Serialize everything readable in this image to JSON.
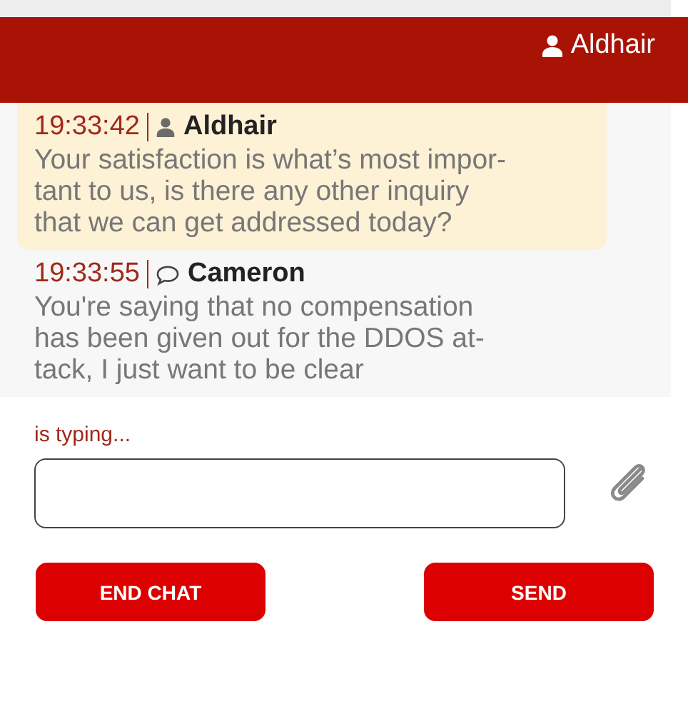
{
  "header": {
    "user": "Aldhair"
  },
  "messages": [
    {
      "kind": "agent",
      "highlighted": true,
      "time": "19:33:42",
      "author": "Aldhair",
      "lines": [
        "Your satisfaction is what’s most impor-",
        "tant to us, is there any other inquiry",
        "that we can get addressed today?"
      ]
    },
    {
      "kind": "customer",
      "highlighted": false,
      "time": "19:33:55",
      "author": "Cameron",
      "lines": [
        "You're saying that no compensation",
        "has been given out for the DDOS at-",
        "tack, I just want to be clear"
      ]
    }
  ],
  "typing": "is typing...",
  "buttons": [
    {
      "label": "END CHAT"
    },
    {
      "label": "SEND"
    }
  ]
}
